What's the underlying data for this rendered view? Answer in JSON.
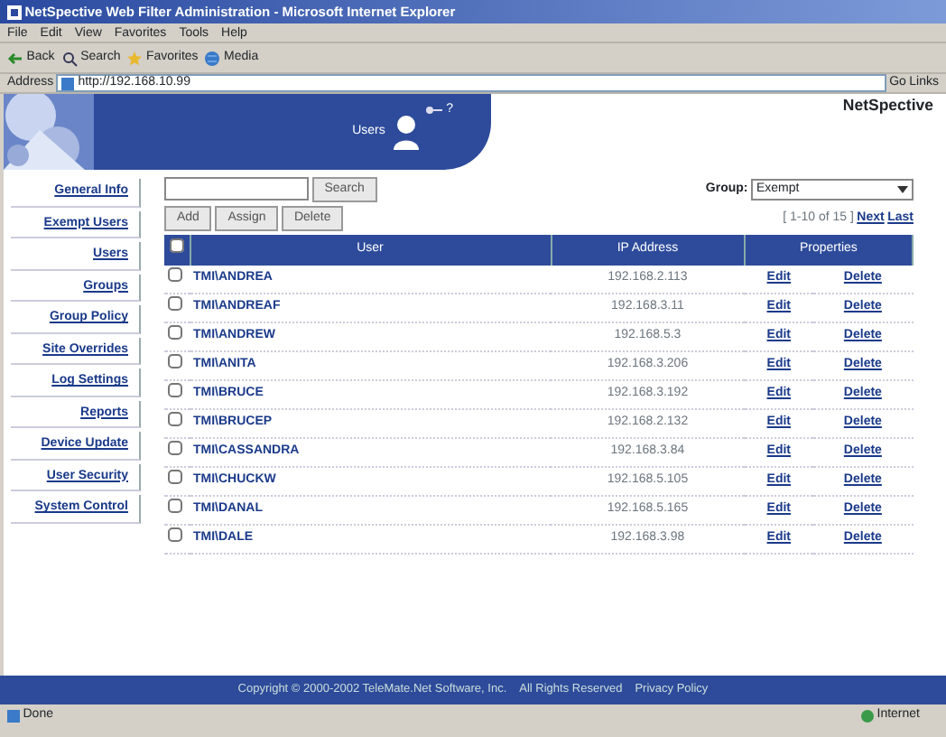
{
  "window": {
    "title": "NetSpective Web Filter Administration - Microsoft Internet Explorer"
  },
  "menu": [
    "File",
    "Edit",
    "View",
    "Favorites",
    "Tools",
    "Help"
  ],
  "toolbar": [
    "Back",
    "Search",
    "Favorites",
    "Media"
  ],
  "address": {
    "label": "Address",
    "value": "http://192.168.10.99",
    "go": "Go",
    "links": "Links"
  },
  "header": {
    "title": "Users",
    "help": "?",
    "logo": "NetSpective"
  },
  "sidebar": [
    "General Info",
    "Exempt Users",
    "Users",
    "Groups",
    "Group Policy",
    "Site Overrides",
    "Log Settings",
    "Reports",
    "Device Update",
    "User Security",
    "System Control"
  ],
  "search_button": "Search",
  "group": {
    "label": "Group:",
    "value": "Exempt"
  },
  "actions": [
    "Add",
    "Assign",
    "Delete"
  ],
  "pager": {
    "range": "[ 1-10 of 15 ]",
    "next": "Next",
    "last": "Last"
  },
  "table": {
    "all_checked": false,
    "columns": [
      "User",
      "IP Address",
      "Properties"
    ],
    "rows": [
      {
        "user": "TMI\\ANDREA",
        "ip": "192.168.2.113",
        "edit": "Edit",
        "delete": "Delete",
        "checked": false
      },
      {
        "user": "TMI\\ANDREAF",
        "ip": "192.168.3.11",
        "edit": "Edit",
        "delete": "Delete",
        "checked": false
      },
      {
        "user": "TMI\\ANDREW",
        "ip": "192.168.5.3",
        "edit": "Edit",
        "delete": "Delete",
        "checked": false
      },
      {
        "user": "TMI\\ANITA",
        "ip": "192.168.3.206",
        "edit": "Edit",
        "delete": "Delete",
        "checked": false
      },
      {
        "user": "TMI\\BRUCE",
        "ip": "192.168.3.192",
        "edit": "Edit",
        "delete": "Delete",
        "checked": false
      },
      {
        "user": "TMI\\BRUCEP",
        "ip": "192.168.2.132",
        "edit": "Edit",
        "delete": "Delete",
        "checked": false
      },
      {
        "user": "TMI\\CASSANDRA",
        "ip": "192.168.3.84",
        "edit": "Edit",
        "delete": "Delete",
        "checked": false
      },
      {
        "user": "TMI\\CHUCKW",
        "ip": "192.168.5.105",
        "edit": "Edit",
        "delete": "Delete",
        "checked": false
      },
      {
        "user": "TMI\\DANAL",
        "ip": "192.168.5.165",
        "edit": "Edit",
        "delete": "Delete",
        "checked": false
      },
      {
        "user": "TMI\\DALE",
        "ip": "192.168.3.98",
        "edit": "Edit",
        "delete": "Delete",
        "checked": false
      }
    ]
  },
  "footer": {
    "copyright": "Copyright © 2000-2002 TeleMate.Net Software, Inc.",
    "rights": "All Rights Reserved",
    "privacy": "Privacy Policy"
  },
  "status_bar": {
    "text": "Done",
    "zone": "Internet"
  }
}
